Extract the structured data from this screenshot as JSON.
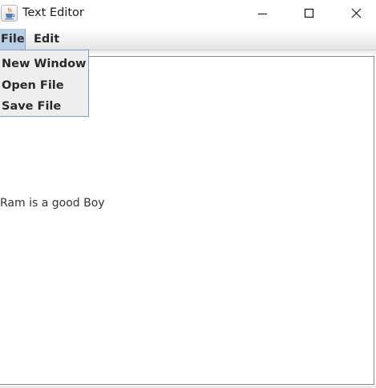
{
  "window": {
    "title": "Text Editor"
  },
  "menubar": {
    "file": "File",
    "edit": "Edit"
  },
  "file_menu": {
    "items": [
      {
        "label": "New Window"
      },
      {
        "label": "Open File"
      },
      {
        "label": "Save File"
      }
    ]
  },
  "editor": {
    "text": "Ram is a good Boy"
  },
  "colors": {
    "menu_selected": "#b8cfe5",
    "popup_border": "#7f9dbf",
    "popup_bg": "#eeeeee"
  },
  "icons": {
    "app": "java-coffee-cup-icon",
    "minimize": "minimize-icon",
    "maximize": "maximize-icon",
    "close": "close-icon"
  }
}
